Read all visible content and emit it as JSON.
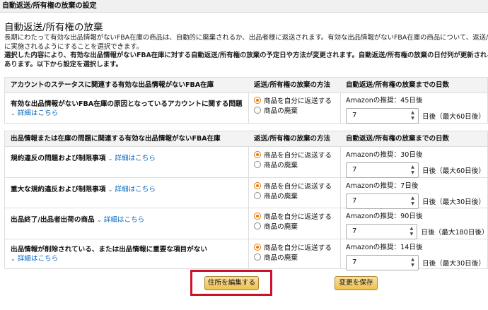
{
  "header": {
    "title": "自動返送/所有権の放棄の設定"
  },
  "section": {
    "title": "自動返送/所有権の放棄",
    "desc_line1": "長期にわたって有効な出品情報がないFBA在庫の商品は、自動的に廃棄されるか、出品者様に返送されます。有効な出品情報がないFBA在庫の商品について、返送/所有",
    "desc_line2": "に実施されるようにすることを選択できます。",
    "desc_line3": "選択した内容により、有効な出品情報がないFBA在庫に対する自動返送/所有権の放棄の予定日や方法が変更されます。自動返送/所有権の放棄の日付列が更新されるま",
    "desc_line4": "あります。以下から設定を選択します。"
  },
  "table1": {
    "col1": "アカウントのステータスに関連する有効な出品情報がないFBA在庫",
    "col2": "返送/所有権の放棄の方法",
    "col3": "自動返送/所有権の放棄までの日数",
    "rows": [
      {
        "title": "有効な出品情報がないFBA在庫の原因となっているアカウントに関する問題",
        "more": "詳細はこちら",
        "opt1": "商品を自分に返送する",
        "opt2": "商品の廃棄",
        "rec": "Amazonの推奨：45日後",
        "value": "7",
        "suffix": "日後（最大60日後）"
      }
    ]
  },
  "table2": {
    "col1": "出品情報または在庫の問題に関連する有効な出品情報がないFBA在庫",
    "col2": "返送/所有権の放棄の方法",
    "col3": "自動返送/所有権の放棄までの日数",
    "rows": [
      {
        "title": "規約違反の問題および制限事項",
        "more": "詳細はこちら",
        "opt1": "商品を自分に返送する",
        "opt2": "商品の廃棄",
        "rec": "Amazonの推奨：30日後",
        "value": "7",
        "suffix": "日後（最大60日後）"
      },
      {
        "title": "重大な規約違反および制限事項",
        "more": "詳細はこちら",
        "opt1": "商品を自分に返送する",
        "opt2": "商品の廃棄",
        "rec": "Amazonの推奨：7日後",
        "value": "7",
        "suffix": "日後（最大30日後）"
      },
      {
        "title": "出品終了/出品者出荷の商品",
        "more": "詳細はこちら",
        "opt1": "商品を自分に返送する",
        "opt2": "商品の廃棄",
        "rec": "Amazonの推奨：90日後",
        "value": "7",
        "suffix": "日後（最大180日後）"
      },
      {
        "title": "出品情報が削除されている、または出品情報に重要な項目がない",
        "more": "詳細はこちら",
        "opt1": "商品を自分に返送する",
        "opt2": "商品の廃棄",
        "rec": "Amazonの推奨：14日後",
        "value": "7",
        "suffix": "日後（最大30日後）"
      }
    ]
  },
  "buttons": {
    "edit_address": "住所を編集する",
    "save": "変更を保存"
  },
  "colors": {
    "accent": "#e77600",
    "link": "#0066c0",
    "highlight": "#d0102a"
  }
}
